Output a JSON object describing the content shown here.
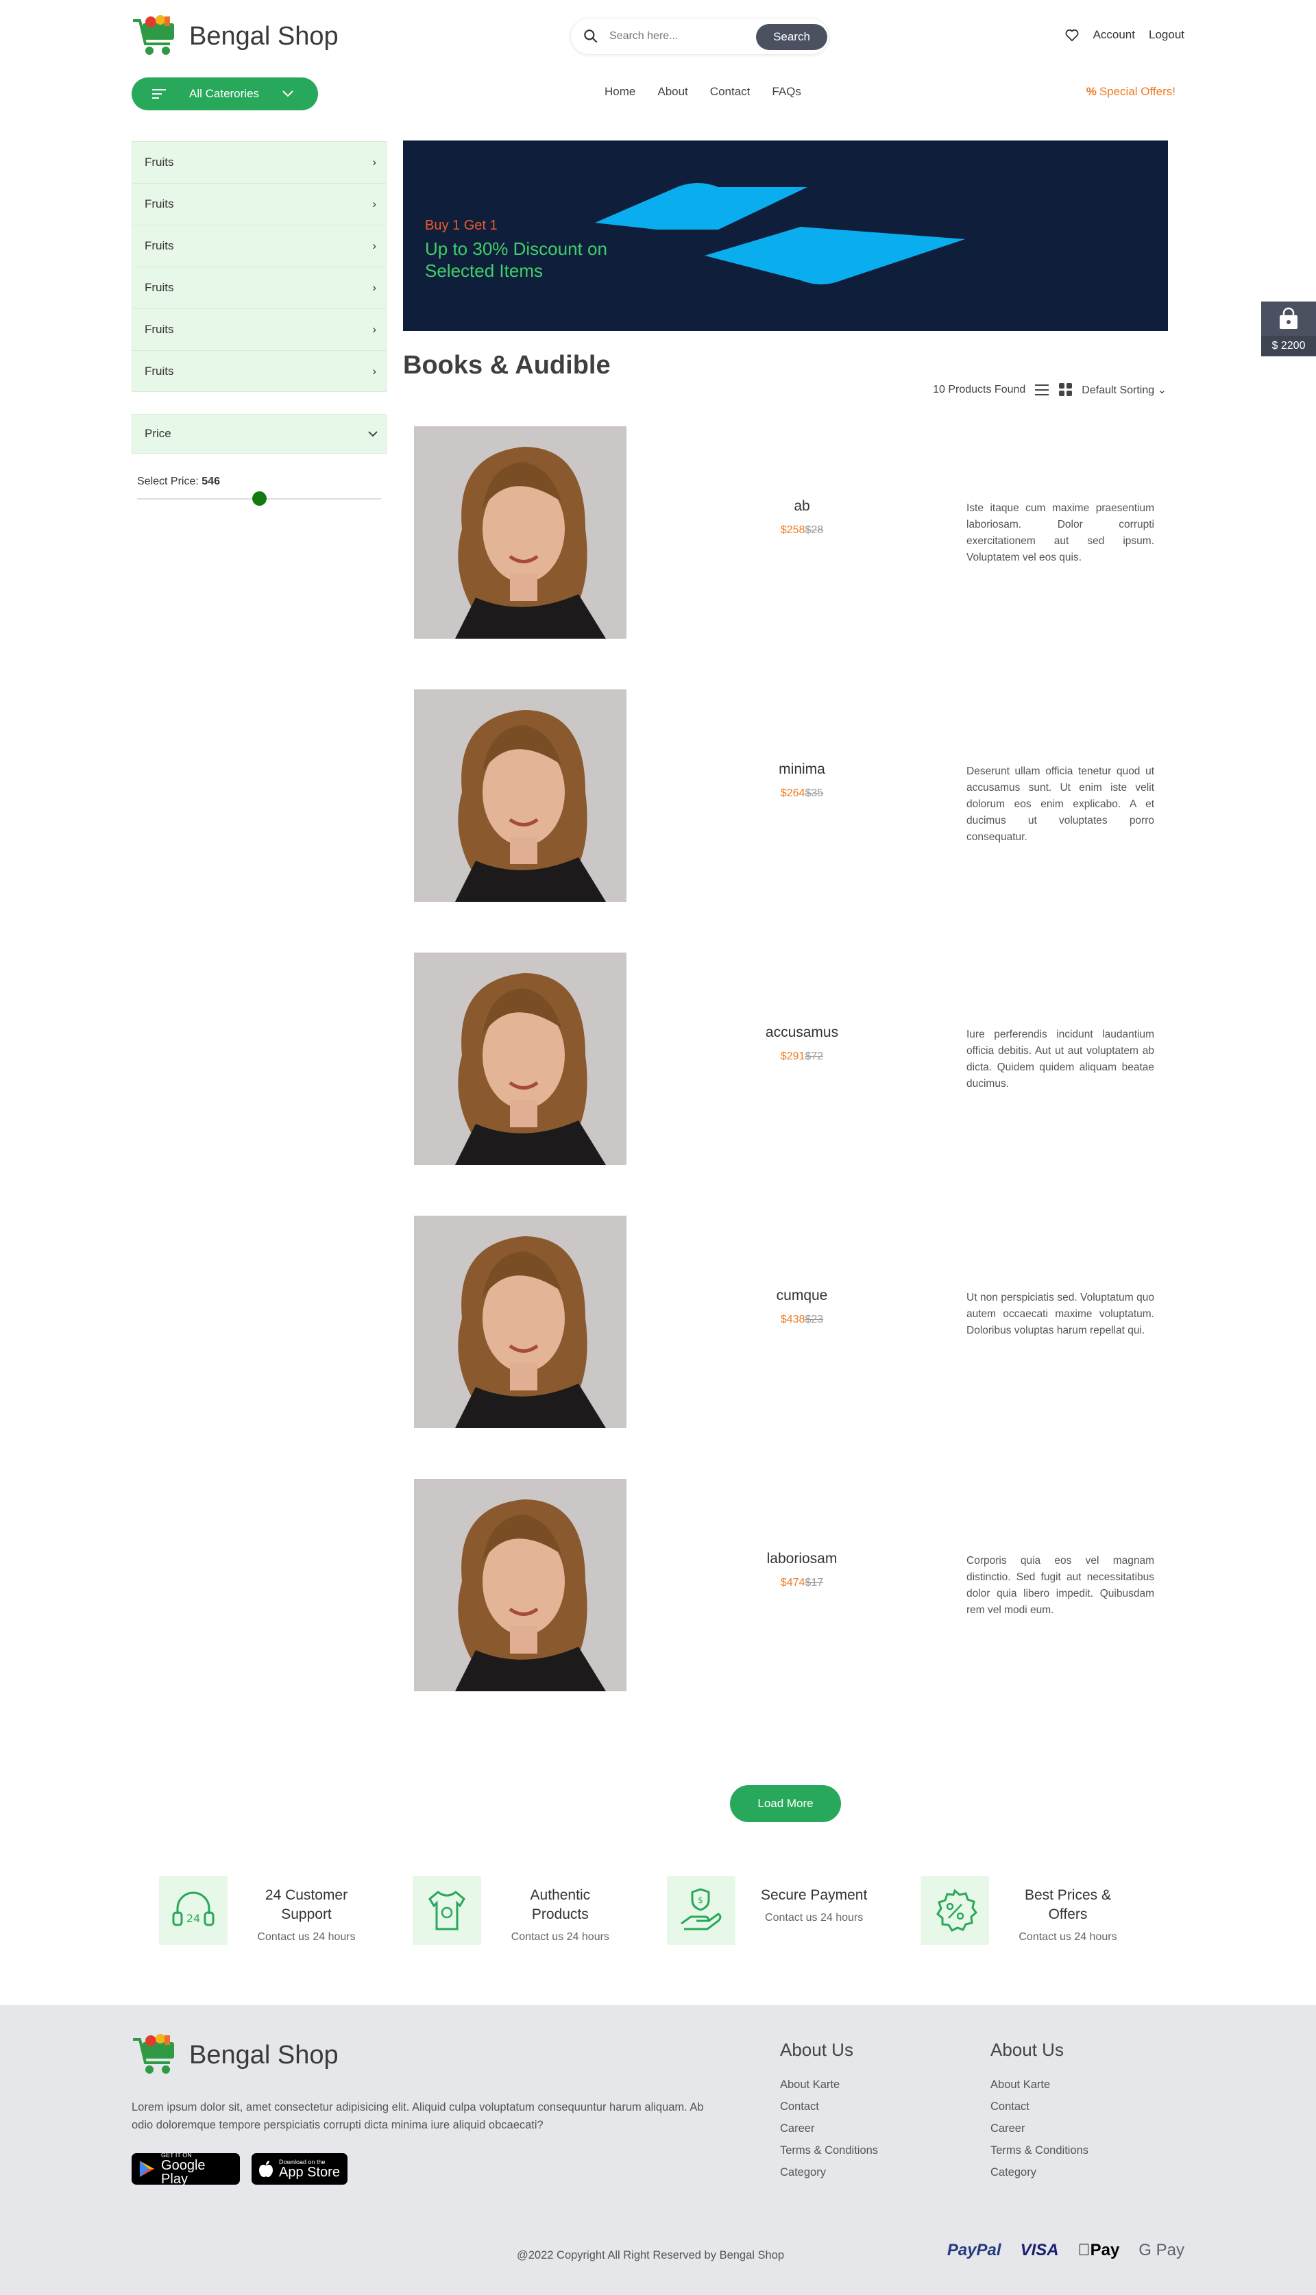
{
  "header": {
    "brand": "Bengal Shop",
    "search_placeholder": "Search here...",
    "search_button": "Search",
    "account": "Account",
    "logout": "Logout",
    "categories_button": "All Caterories",
    "nav": [
      "Home",
      "About",
      "Contact",
      "FAQs"
    ],
    "special_offers": "Special Offers!"
  },
  "sidebar": {
    "categories": [
      "Fruits",
      "Fruits",
      "Fruits",
      "Fruits",
      "Fruits",
      "Fruits"
    ],
    "price_title": "Price",
    "select_price_label": "Select Price:",
    "select_price_value": "546",
    "slider_fraction": 0.5
  },
  "banner": {
    "small": "Buy 1 Get 1",
    "big": "Up to 30% Discount on Selected Items"
  },
  "main": {
    "title": "Books & Audible",
    "products_found": "10 Products Found",
    "sorting": "Default Sorting"
  },
  "products": [
    {
      "name": "ab",
      "price": "$258",
      "old_price": "$28",
      "desc": "Iste itaque cum maxime praesentium laboriosam. Dolor corrupti exercitationem aut sed ipsum. Voluptatem vel eos quis."
    },
    {
      "name": "minima",
      "price": "$264",
      "old_price": "$35",
      "desc": "Deserunt ullam officia tenetur quod ut accusamus sunt. Ut enim iste velit dolorum eos enim explicabo. A et ducimus ut voluptates porro consequatur."
    },
    {
      "name": "accusamus",
      "price": "$291",
      "old_price": "$72",
      "desc": "Iure perferendis incidunt laudantium officia debitis. Aut ut aut voluptatem ab dicta. Quidem quidem aliquam beatae ducimus."
    },
    {
      "name": "cumque",
      "price": "$438",
      "old_price": "$23",
      "desc": "Ut non perspiciatis sed. Voluptatum quo autem occaecati maxime voluptatum. Doloribus voluptas harum repellat qui."
    },
    {
      "name": "laboriosam",
      "price": "$474",
      "old_price": "$17",
      "desc": "Corporis quia eos vel magnam distinctio. Sed fugit aut necessitatibus dolor quia libero impedit. Quibusdam rem vel modi eum."
    }
  ],
  "load_more": "Load More",
  "features": [
    {
      "title": "24 Customer Support",
      "sub": "Contact us 24 hours",
      "icon": "headset-icon"
    },
    {
      "title": "Authentic Products",
      "sub": "Contact us 24 hours",
      "icon": "shirt-icon"
    },
    {
      "title": "Secure Payment",
      "sub": "Contact us 24 hours",
      "icon": "secure-payment-icon"
    },
    {
      "title": "Best Prices & Offers",
      "sub": "Contact us 24 hours",
      "icon": "discount-icon"
    }
  ],
  "footer": {
    "brand": "Bengal Shop",
    "about_text": "Lorem ipsum dolor sit, amet consectetur adipisicing elit. Aliquid culpa voluptatum consequuntur harum aliquam. Ab odio doloremque tempore perspiciatis corrupti dicta minima iure aliquid obcaecati?",
    "google_small": "GET IT ON",
    "google_big": "Google Play",
    "apple_small": "Download on the",
    "apple_big": "App Store",
    "col1_title": "About Us",
    "col1_links": [
      "About Karte",
      "Contact",
      "Career",
      "Terms & Conditions",
      "Category"
    ],
    "col2_title": "About Us",
    "col2_links": [
      "About Karte",
      "Contact",
      "Career",
      "Terms & Conditions",
      "Category"
    ],
    "copyright": "@2022 Copyright All Right Reserved by Bengal Shop",
    "payments": [
      "PayPal",
      "VISA",
      "Pay",
      "G Pay"
    ]
  },
  "cart": {
    "total": "$ 2200"
  },
  "colors": {
    "green": "#28a85a",
    "orange": "#f07a22",
    "navy": "#0f1f3b",
    "dark": "#4b5161"
  }
}
